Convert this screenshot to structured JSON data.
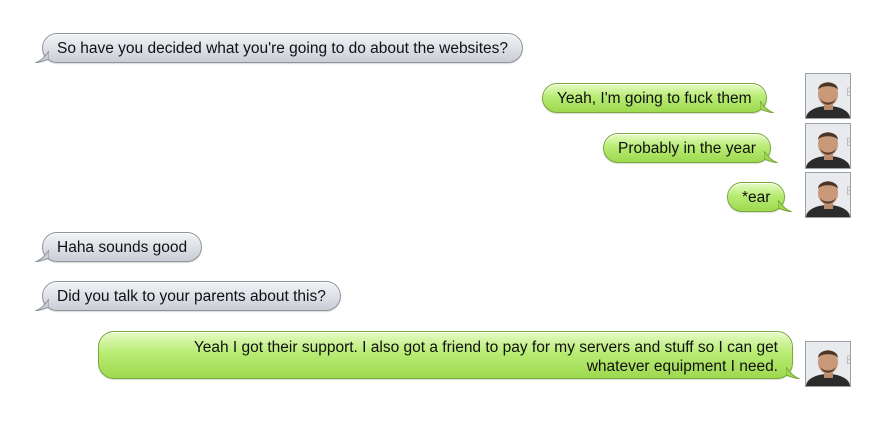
{
  "conversation": {
    "messages": [
      {
        "side": "received",
        "text": "So have you decided what you're going to do about the websites?"
      },
      {
        "side": "sent",
        "text": "Yeah, I'm going to fuck them"
      },
      {
        "side": "sent",
        "text": "Probably in the year"
      },
      {
        "side": "sent",
        "text": "*ear"
      },
      {
        "side": "received",
        "text": "Haha sounds good"
      },
      {
        "side": "received",
        "text": "Did you talk to your parents about this?"
      },
      {
        "side": "sent",
        "text_line1": "Yeah I got their support. I also got a friend to pay for my servers and stuff so I can get",
        "text_line2": "whatever equipment I need."
      }
    ]
  },
  "colors": {
    "received_bubble": "#d9dce2",
    "sent_bubble": "#b2e86a",
    "background": "#ffffff"
  },
  "icons": {
    "avatar": "sender-avatar-photo"
  }
}
